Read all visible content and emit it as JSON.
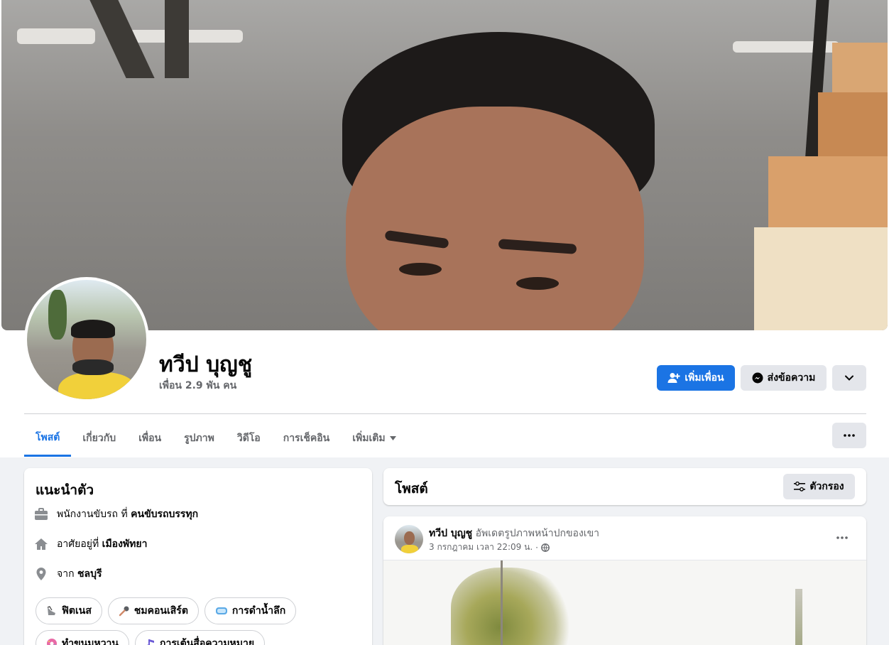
{
  "profile": {
    "name": "ทวีป บุญชู",
    "friends": "เพื่อน 2.9 พัน คน"
  },
  "actions": {
    "add_friend": "เพิ่มเพื่อน",
    "message": "ส่งข้อความ"
  },
  "tabs": [
    {
      "label": "โพสต์",
      "active": true
    },
    {
      "label": "เกี่ยวกับ",
      "active": false
    },
    {
      "label": "เพื่อน",
      "active": false
    },
    {
      "label": "รูปภาพ",
      "active": false
    },
    {
      "label": "วิดีโอ",
      "active": false
    },
    {
      "label": "การเช็คอิน",
      "active": false
    },
    {
      "label": "เพิ่มเติม",
      "active": false
    }
  ],
  "intro": {
    "title": "แนะนำตัว",
    "work_prefix": "พนักงานขับรถ ที่",
    "work_value": "คนขับรถบรรทุก",
    "lives_prefix": "อาศัยอยู่ที่",
    "lives_value": "เมืองพัทยา",
    "from_prefix": "จาก",
    "from_value": "ชลบุรี",
    "hobbies": [
      {
        "label": "ฟิตเนส",
        "icon": "shoe-icon"
      },
      {
        "label": "ชมคอนเสิร์ต",
        "icon": "microphone-icon"
      },
      {
        "label": "การดำน้ำลึก",
        "icon": "diving-mask-icon"
      },
      {
        "label": "ทำขนมหวาน",
        "icon": "donut-icon"
      },
      {
        "label": "การเต้นสื่อความหมาย",
        "icon": "music-note-icon"
      }
    ]
  },
  "posts": {
    "title": "โพสต์",
    "filter_label": "ตัวกรอง",
    "item": {
      "author": "ทวีป บุญชู",
      "action": "อัพเดตรูปภาพหน้าปกของเขา",
      "timestamp": "3 กรกฎาคม เวลา 22:09 น.",
      "separator": "·"
    }
  },
  "colors": {
    "accent": "#1b74e4",
    "secondary_button": "#e4e6eb",
    "background": "#f0f2f5",
    "muted_text": "#65676b"
  }
}
